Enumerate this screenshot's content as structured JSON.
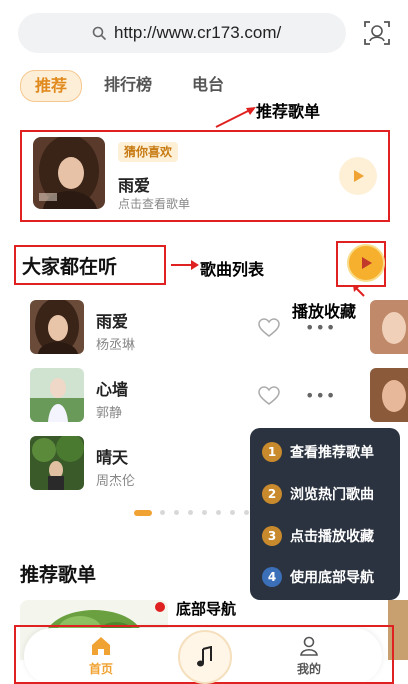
{
  "search": {
    "url": "http://www.cr173.com/"
  },
  "tabs": [
    {
      "label": "推荐",
      "active": true
    },
    {
      "label": "排行榜",
      "active": false
    },
    {
      "label": "电台",
      "active": false
    }
  ],
  "annotations": {
    "recommend_playlist": "推荐歌单",
    "song_list": "歌曲列表",
    "play_collect": "播放收藏",
    "bottom_nav": "底部导航"
  },
  "recommend_card": {
    "badge": "猜你喜欢",
    "title": "雨爱",
    "subtitle": "点击查看歌单"
  },
  "section": {
    "title": "大家都在听"
  },
  "songs": [
    {
      "title": "雨爱",
      "artist": "杨丞琳"
    },
    {
      "title": "心墙",
      "artist": "郭静"
    },
    {
      "title": "晴天",
      "artist": "周杰伦"
    }
  ],
  "steps": [
    {
      "num": "1",
      "text": "查看推荐歌单"
    },
    {
      "num": "2",
      "text": "浏览热门歌曲"
    },
    {
      "num": "3",
      "text": "点击播放收藏"
    },
    {
      "num": "4",
      "text": "使用底部导航"
    }
  ],
  "recommend_section": {
    "title": "推荐歌单"
  },
  "bottom_nav": {
    "home_label": "首页",
    "mine_label": "我的"
  },
  "colors": {
    "accent": "#f0a232",
    "annotation_red": "#e02121",
    "overlay": "#2b3340"
  }
}
